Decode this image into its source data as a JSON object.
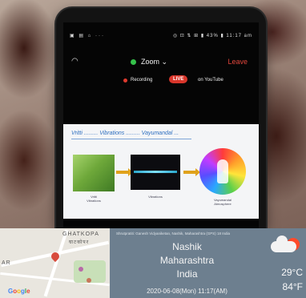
{
  "phone": {
    "status_left": "▣ ▤ ⌂  ···",
    "status_right": "◎ ⊡ ⇅ ⊞ ▮ 43% ▮ 11:17 am",
    "zoom_title": "Zoom",
    "zoom_caret": "⌄",
    "leave_label": "Leave",
    "recording_label": "Recording",
    "live_label": "LIVE",
    "youtube_label": "on YouTube",
    "slide_title": "Vritti ......... Vibrations ......... Vayumandal ...",
    "caption_1": "Vritti\nVibrations",
    "caption_2": "Vibrations",
    "caption_3": "Vayumandal\nAtmosphere"
  },
  "info": {
    "header": "Shrutpratiti: Ganesh Vidyaniketan, Nashik, Maharashtra (GPS) 18 India",
    "city": "Nashik",
    "state": "Maharashtra",
    "country": "India",
    "datetime": "2020-06-08(Mon)  11:17(AM)"
  },
  "weather": {
    "temp_c": "29°C",
    "temp_f": "84°F",
    "icon": "partly-cloudy-icon"
  },
  "map": {
    "label_1": "GHATKOPA",
    "label_2": "घाटकोपर",
    "label_3": "AR",
    "google_g": "G",
    "google_o1": "o",
    "google_o2": "o",
    "google_g2": "g",
    "google_l": "l",
    "google_e": "e"
  },
  "colors": {
    "leave": "#e2463c",
    "live": "#d9362b",
    "info_bg": "#6d7f8f",
    "slide_title": "#2e6fbf"
  }
}
